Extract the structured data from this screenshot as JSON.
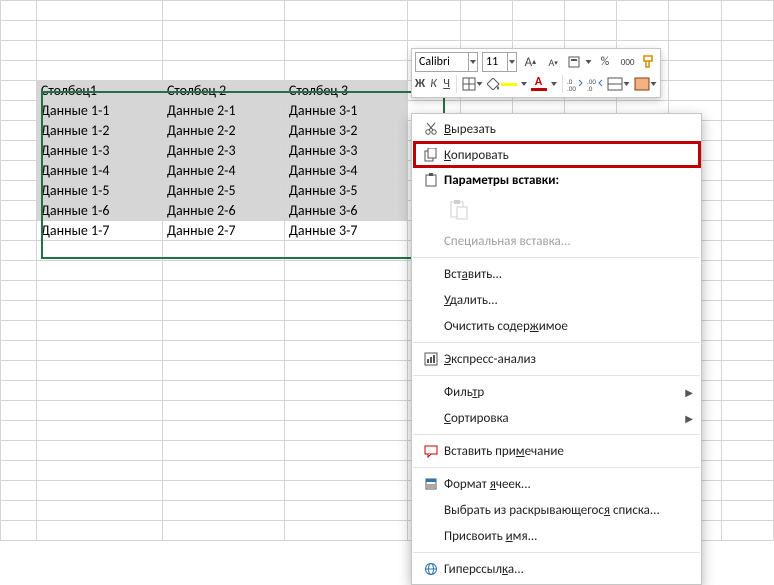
{
  "chart_data": {
    "type": "table",
    "columns": [
      "Столбец1",
      "Столбец 2",
      "Столбец 3"
    ],
    "rows": [
      [
        "Данные 1-1",
        "Данные 2-1",
        "Данные 3-1"
      ],
      [
        "Данные 1-2",
        "Данные 2-2",
        "Данные 3-2"
      ],
      [
        "Данные 1-3",
        "Данные 2-3",
        "Данные 3-3"
      ],
      [
        "Данные 1-4",
        "Данные 2-4",
        "Данные 3-4"
      ],
      [
        "Данные 1-5",
        "Данные 2-5",
        "Данные 3-5"
      ],
      [
        "Данные 1-6",
        "Данные 2-6",
        "Данные 3-6"
      ],
      [
        "Данные 1-7",
        "Данные 2-7",
        "Данные 3-7"
      ]
    ]
  },
  "table": {
    "headers": [
      "Столбец1",
      "Столбец 2",
      "Столбец 3"
    ],
    "rows": [
      [
        "Данные 1-1",
        "Данные 2-1",
        "Данные 3-1"
      ],
      [
        "Данные 1-2",
        "Данные 2-2",
        "Данные 3-2"
      ],
      [
        "Данные 1-3",
        "Данные 2-3",
        "Данные 3-3"
      ],
      [
        "Данные 1-4",
        "Данные 2-4",
        "Данные 3-4"
      ],
      [
        "Данные 1-5",
        "Данные 2-5",
        "Данные 3-5"
      ],
      [
        "Данные 1-6",
        "Данные 2-6",
        "Данные 3-6"
      ],
      [
        "Данные 1-7",
        "Данные 2-7",
        "Данные 3-7"
      ]
    ]
  },
  "mini": {
    "font": "Calibri",
    "size": "11",
    "percent": "%",
    "thousand": "000",
    "bold": "Ж",
    "italic": "К"
  },
  "menu": {
    "cut": "Вырезать",
    "copy": "Копировать",
    "paste_options": "Параметры вставки:",
    "paste_special": "Специальная вставка...",
    "insert": "Вставить...",
    "delete": "Удалить...",
    "clear": "Очистить содержимое",
    "quick_analysis": "Экспресс-анализ",
    "filter": "Фильтр",
    "sort": "Сортировка",
    "comment": "Вставить примечание",
    "format": "Формат ячеек...",
    "dropdown": "Выбрать из раскрывающегося списка...",
    "define_name": "Присвоить имя...",
    "hyperlink": "Гиперссылка..."
  }
}
